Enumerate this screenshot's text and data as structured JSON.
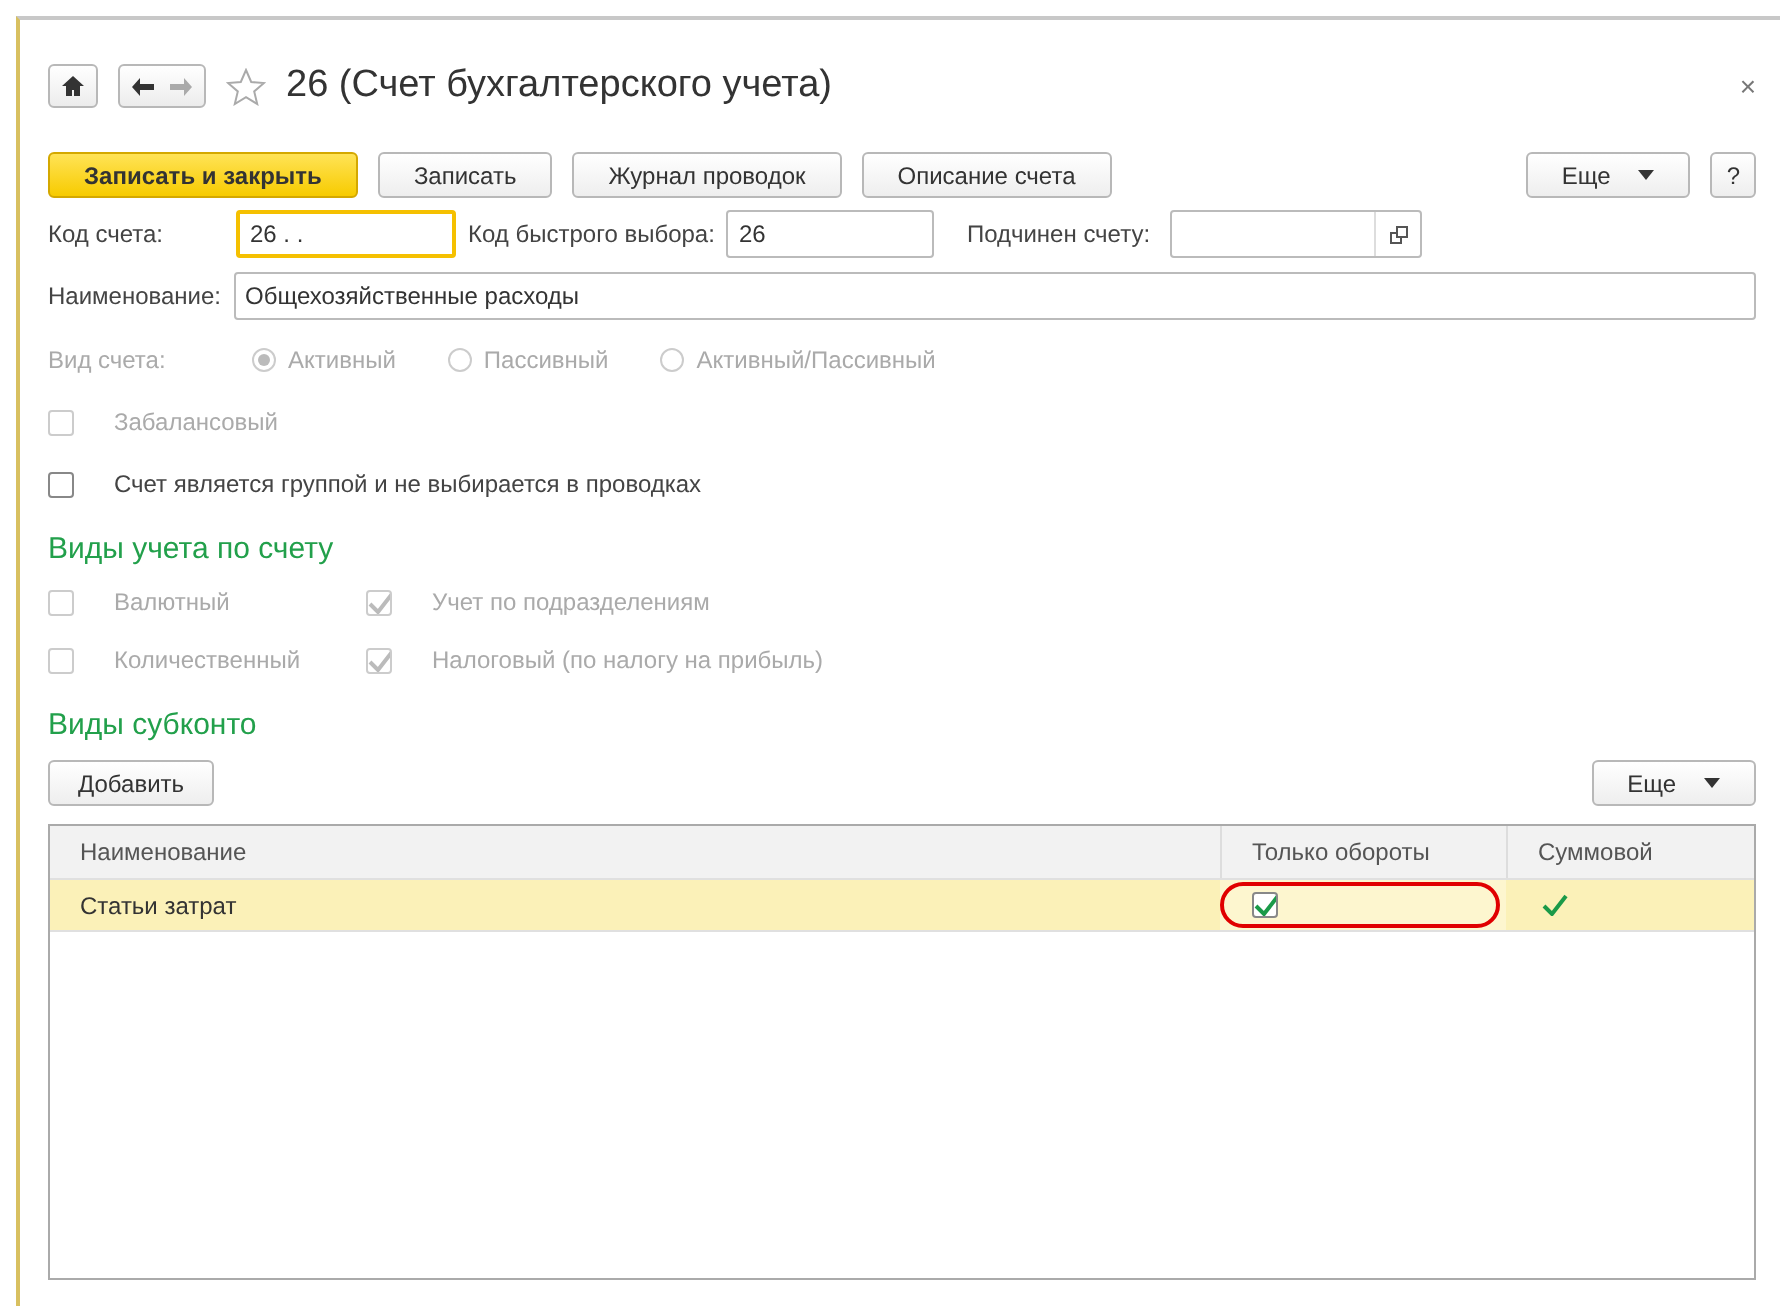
{
  "window": {
    "title": "26 (Счет бухгалтерского учета)",
    "close": "×"
  },
  "toolbar": {
    "buttons": [
      {
        "label": "Записать и закрыть",
        "kind": "primary"
      },
      {
        "label": "Записать",
        "kind": "plain"
      },
      {
        "label": "Журнал проводок",
        "kind": "plain"
      },
      {
        "label": "Описание счета",
        "kind": "plain"
      }
    ],
    "more": "Еще",
    "help": "?"
  },
  "fields": {
    "code": {
      "label": "Код счета:",
      "value": "26 .  ."
    },
    "quick": {
      "label": "Код быстрого выбора:",
      "value": "26"
    },
    "parent": {
      "label": "Подчинен счету:"
    },
    "name": {
      "label": "Наименование:",
      "value": "Общехозяйственные расходы"
    }
  },
  "account_type": {
    "label": "Вид счета:",
    "disabled": true,
    "options": [
      {
        "label": "Активный",
        "selected": true
      },
      {
        "label": "Пассивный",
        "selected": false
      },
      {
        "label": "Активный/Пассивный",
        "selected": false
      }
    ]
  },
  "flags": [
    {
      "label": "Забалансовый",
      "checked": false,
      "disabled": true
    },
    {
      "label": "Счет является группой и не выбирается в проводках",
      "checked": false,
      "disabled": false
    }
  ],
  "accounting_section": {
    "title": "Виды учета по счету",
    "rows": [
      [
        {
          "label": "Валютный",
          "checked": false,
          "disabled": true
        },
        {
          "label": "Учет по подразделениям",
          "checked": true,
          "disabled": true
        }
      ],
      [
        {
          "label": "Количественный",
          "checked": false,
          "disabled": true
        },
        {
          "label": "Налоговый (по налогу на прибыль)",
          "checked": true,
          "disabled": true
        }
      ]
    ]
  },
  "subconto": {
    "title": "Виды субконто",
    "add": "Добавить",
    "more": "Еще",
    "columns": [
      "Наименование",
      "Только обороты",
      "Суммовой"
    ],
    "rows": [
      {
        "name": "Статьи затрат",
        "turnover_only": true,
        "sum": true,
        "selected": true,
        "highlighted": true
      }
    ]
  }
}
